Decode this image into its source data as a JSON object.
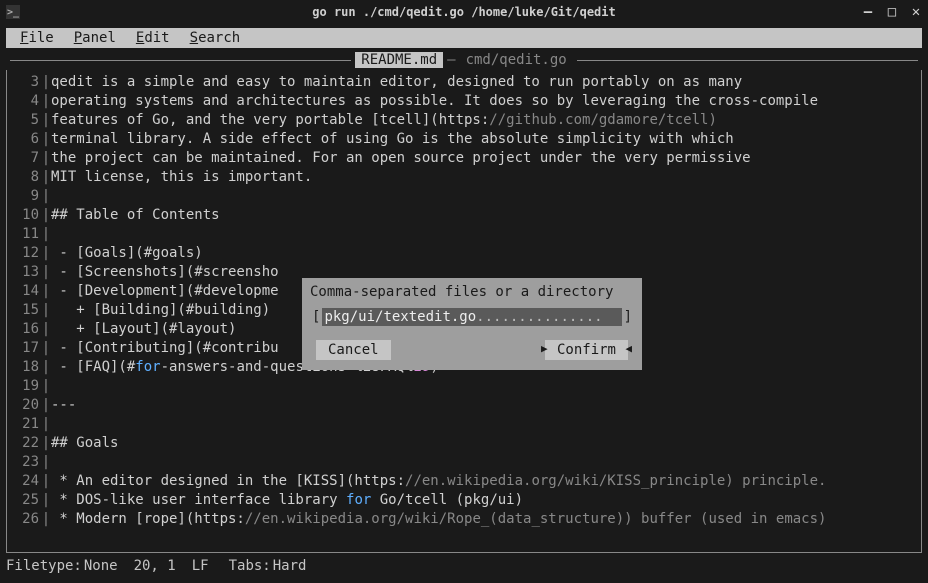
{
  "window": {
    "title": "go run ./cmd/qedit.go /home/luke/Git/qedit",
    "icon_name": "terminal-icon"
  },
  "menu": {
    "items": [
      {
        "label": "File",
        "accel": "F"
      },
      {
        "label": "Panel",
        "accel": "P"
      },
      {
        "label": "Edit",
        "accel": "E"
      },
      {
        "label": "Search",
        "accel": "S"
      }
    ]
  },
  "tabs": {
    "active": "README.md",
    "inactive": "cmd/qedit.go"
  },
  "editor": {
    "lines": [
      {
        "n": 3,
        "segs": [
          {
            "t": "qedit is a simple and easy to maintain editor, designed to run portably on as many",
            "c": ""
          }
        ]
      },
      {
        "n": 4,
        "segs": [
          {
            "t": "operating systems and architectures as possible. It does so by leveraging the cross-compile",
            "c": ""
          }
        ]
      },
      {
        "n": 5,
        "segs": [
          {
            "t": "features of Go, and the very portable [tcell](https:",
            "c": ""
          },
          {
            "t": "//github.com/gdamore/tcell)",
            "c": "c-comment"
          }
        ]
      },
      {
        "n": 6,
        "segs": [
          {
            "t": "terminal library. A side effect of using Go is the absolute simplicity with which",
            "c": ""
          }
        ]
      },
      {
        "n": 7,
        "segs": [
          {
            "t": "the project can be maintained. For an open source project under the very permissive",
            "c": ""
          }
        ]
      },
      {
        "n": 8,
        "segs": [
          {
            "t": "MIT license, this is important.",
            "c": ""
          }
        ]
      },
      {
        "n": 9,
        "segs": [
          {
            "t": "",
            "c": ""
          }
        ]
      },
      {
        "n": 10,
        "segs": [
          {
            "t": "## Table of Contents",
            "c": ""
          }
        ]
      },
      {
        "n": 11,
        "segs": [
          {
            "t": "",
            "c": ""
          }
        ]
      },
      {
        "n": 12,
        "segs": [
          {
            "t": " - [Goals](#goals)",
            "c": ""
          }
        ]
      },
      {
        "n": 13,
        "segs": [
          {
            "t": " - [Screenshots](#screensho",
            "c": ""
          }
        ]
      },
      {
        "n": 14,
        "segs": [
          {
            "t": " - [Development](#developme",
            "c": ""
          }
        ]
      },
      {
        "n": 15,
        "segs": [
          {
            "t": "   + [Building](#building)",
            "c": ""
          }
        ]
      },
      {
        "n": 16,
        "segs": [
          {
            "t": "   + [Layout](#layout)",
            "c": ""
          }
        ]
      },
      {
        "n": 17,
        "segs": [
          {
            "t": " - [Contributing](#contribu",
            "c": ""
          }
        ]
      },
      {
        "n": 18,
        "segs": [
          {
            "t": " - [FAQ](#",
            "c": ""
          },
          {
            "t": "for",
            "c": "c-kw"
          },
          {
            "t": "-answers-and-questions-%28FAQ%",
            "c": ""
          },
          {
            "t": "29",
            "c": "c-num"
          },
          {
            "t": ")",
            "c": ""
          }
        ]
      },
      {
        "n": 19,
        "segs": [
          {
            "t": "",
            "c": ""
          }
        ]
      },
      {
        "n": 20,
        "segs": [
          {
            "t": "---",
            "c": ""
          }
        ]
      },
      {
        "n": 21,
        "segs": [
          {
            "t": "",
            "c": ""
          }
        ]
      },
      {
        "n": 22,
        "segs": [
          {
            "t": "## Goals",
            "c": ""
          }
        ]
      },
      {
        "n": 23,
        "segs": [
          {
            "t": "",
            "c": ""
          }
        ]
      },
      {
        "n": 24,
        "segs": [
          {
            "t": " * An editor designed in the [KISS](https:",
            "c": ""
          },
          {
            "t": "//en.wikipedia.org/wiki/KISS_principle) principle.",
            "c": "c-comment"
          }
        ]
      },
      {
        "n": 25,
        "segs": [
          {
            "t": " * DOS-like user interface library ",
            "c": ""
          },
          {
            "t": "for",
            "c": "c-kw"
          },
          {
            "t": " Go/tcell (pkg/ui)",
            "c": ""
          }
        ]
      },
      {
        "n": 26,
        "segs": [
          {
            "t": " * Modern [rope](https:",
            "c": ""
          },
          {
            "t": "//en.wikipedia.org/wiki/Rope_(data_structure)) buffer (used in emacs)",
            "c": "c-comment"
          }
        ]
      }
    ]
  },
  "dialog": {
    "title": "Comma-separated files or a directory",
    "input_value": "pkg/ui/textedit.go",
    "input_pad": "...............",
    "cancel_label": "Cancel",
    "confirm_label": "Confirm"
  },
  "statusbar": {
    "filetype_label": "Filetype:",
    "filetype": "None",
    "cursor": "20, 1",
    "lineend": "LF",
    "tabs_label": "Tabs:",
    "tabs": "Hard"
  }
}
